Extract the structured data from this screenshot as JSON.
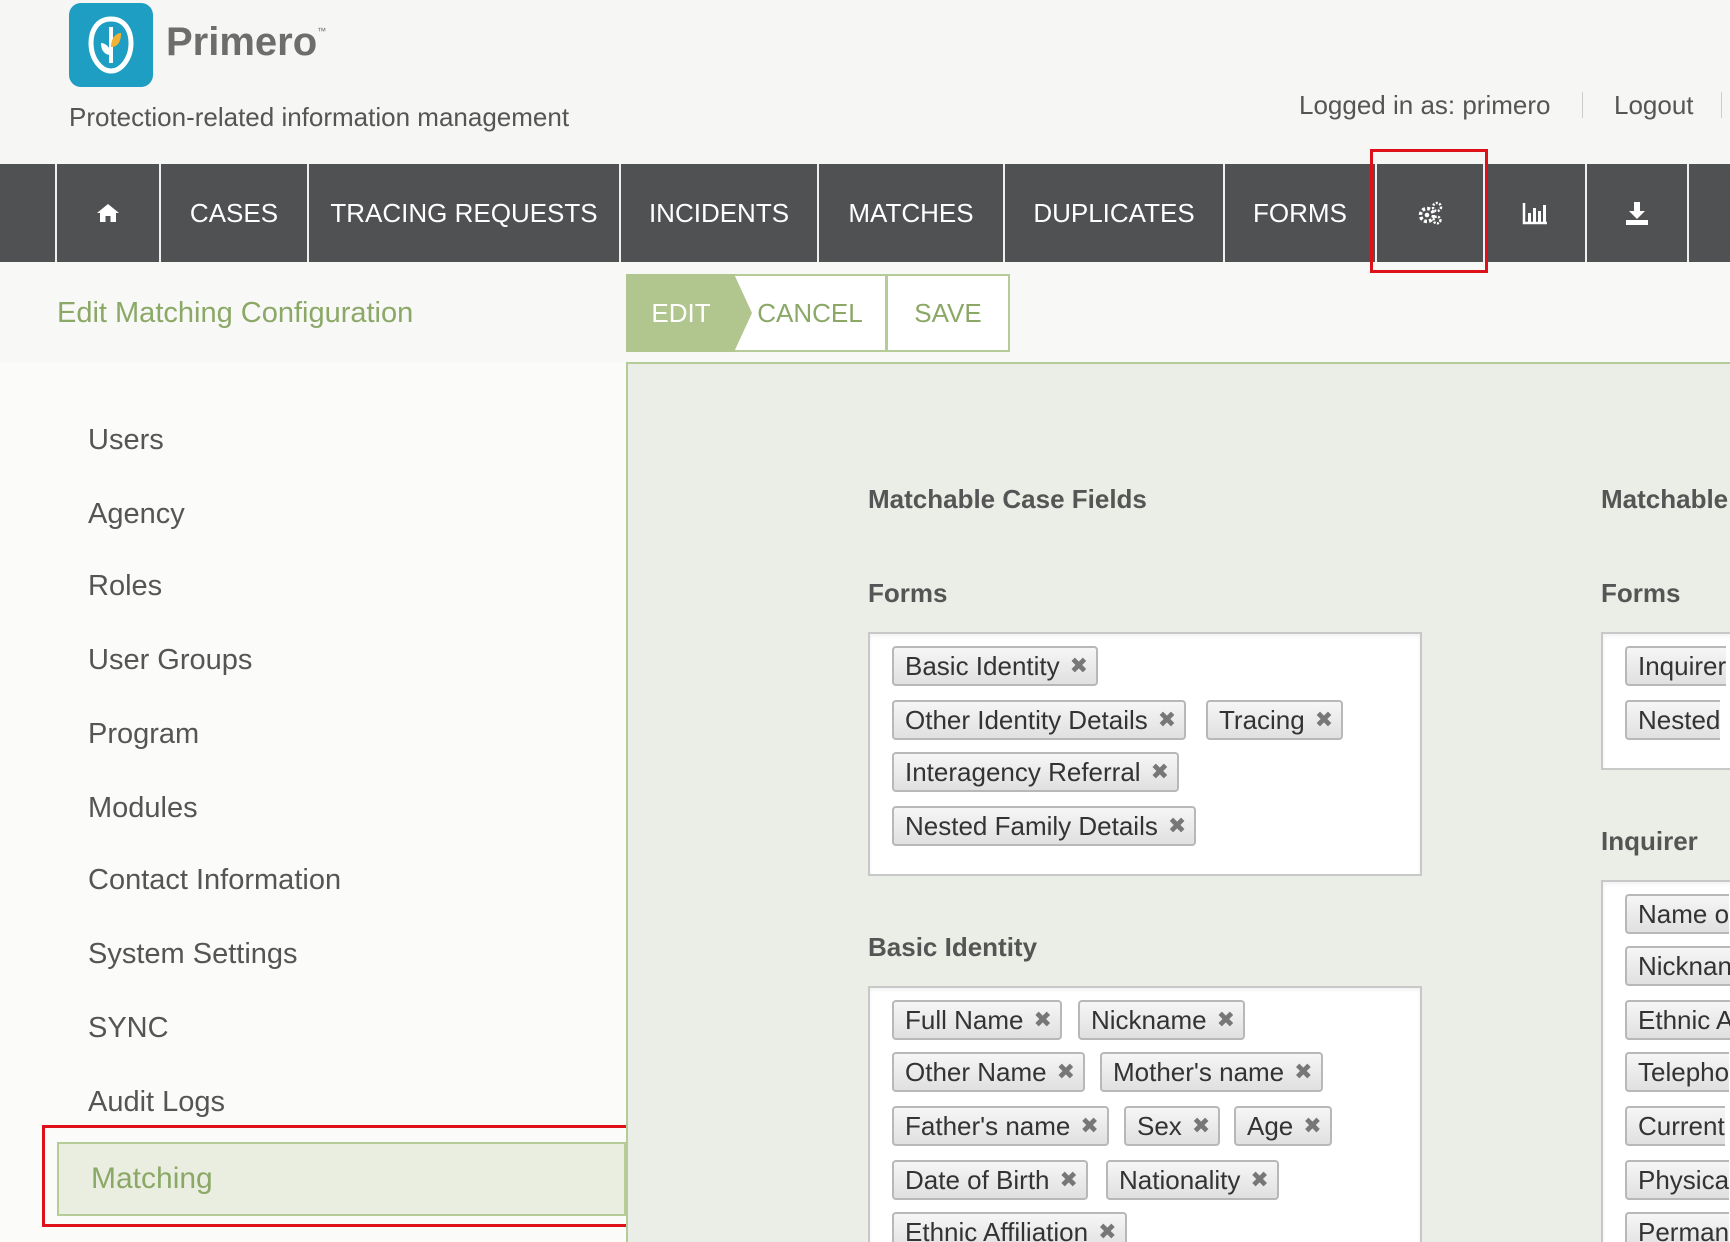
{
  "header": {
    "brand": "Primero",
    "trademark": "™",
    "tagline": "Protection-related information management",
    "logged_in": "Logged in as: primero",
    "logout": "Logout"
  },
  "nav": {
    "home_icon": "home-icon",
    "cases": "CASES",
    "tracing_requests": "TRACING REQUESTS",
    "incidents": "INCIDENTS",
    "matches": "MATCHES",
    "duplicates": "DUPLICATES",
    "forms": "FORMS",
    "settings_icon": "gears-icon",
    "reports_icon": "bar-chart-icon",
    "export_icon": "download-icon"
  },
  "page": {
    "title": "Edit Matching Configuration",
    "actions": {
      "edit": "EDIT",
      "cancel": "CANCEL",
      "save": "SAVE"
    }
  },
  "sidebar": {
    "items": [
      "Users",
      "Agency",
      "Roles",
      "User Groups",
      "Program",
      "Modules",
      "Contact Information",
      "System Settings",
      "SYNC",
      "Audit Logs"
    ],
    "active": "Matching"
  },
  "case_fields": {
    "heading": "Matchable Case Fields",
    "forms_label": "Forms",
    "forms": [
      "Basic Identity",
      "Other Identity Details",
      "Tracing",
      "Interagency Referral",
      "Nested Family Details"
    ],
    "basic_identity_label": "Basic Identity",
    "basic_identity": [
      "Full Name",
      "Nickname",
      "Other Name",
      "Mother's name",
      "Father's name",
      "Sex",
      "Age",
      "Date of Birth",
      "Nationality",
      "Ethnic Affiliation"
    ]
  },
  "tracing_fields": {
    "heading": "Matchable",
    "forms_label": "Forms",
    "forms": [
      "Inquirer",
      "Nested"
    ],
    "inquirer_label": "Inquirer",
    "inquirer": [
      "Name o",
      "Nicknan",
      "Ethnic A",
      "Telepho",
      "Current",
      "Physica",
      "Perman"
    ]
  },
  "colors": {
    "accent": "#8ba867",
    "nav_bg": "#505152",
    "highlight": "#e0101a",
    "logo": "#1e9ec2"
  }
}
